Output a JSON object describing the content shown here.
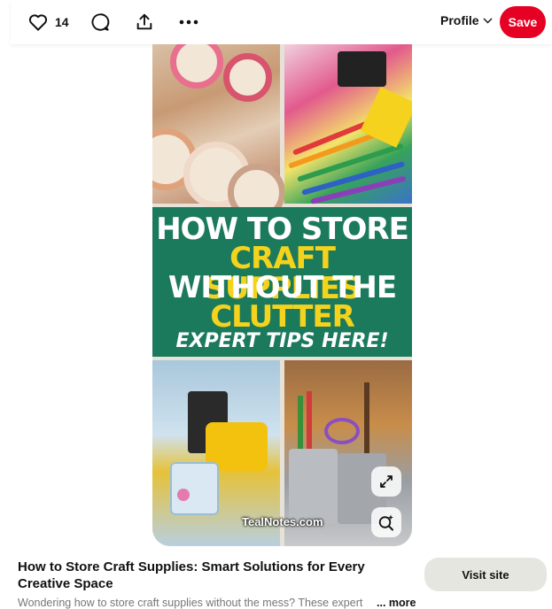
{
  "toolbar": {
    "like_count": "14",
    "profile_label": "Profile",
    "save_label": "Save"
  },
  "pin_image": {
    "banner_line1": "HOW TO STORE",
    "banner_line2": "CRAFT SUPPLIES",
    "banner_line3": "WITHOUT THE",
    "banner_line4": "CLUTTER",
    "banner_line5": "EXPERT TIPS HERE!",
    "watermark": "TealNotes.com",
    "colors": {
      "banner_green": "#1c7a5c",
      "banner_yellow": "#f5d31c"
    }
  },
  "details": {
    "title": "How to Store Craft Supplies: Smart Solutions for Every Creative Space",
    "visit_label": "Visit site",
    "description": "Wondering how to store craft supplies without the mess? These expert",
    "more_label": "... more"
  },
  "icons": [
    "heart-icon",
    "comment-icon",
    "share-icon",
    "more-icon",
    "chevron-down-icon",
    "expand-icon",
    "visual-search-icon"
  ],
  "accent_color": "#e60023"
}
